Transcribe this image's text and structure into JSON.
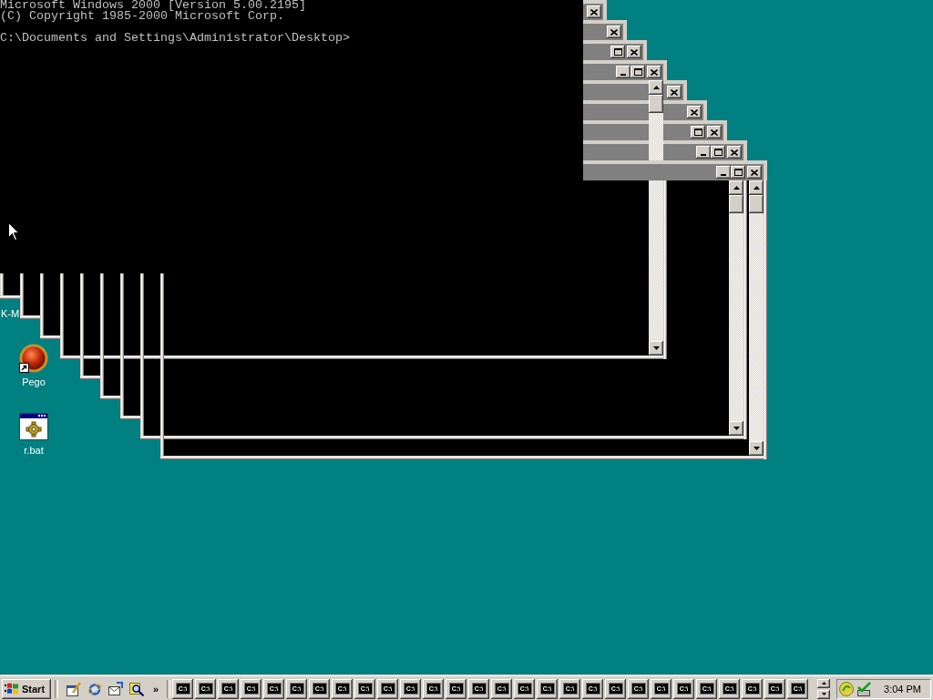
{
  "console": {
    "lines": [
      "Microsoft Windows 2000 [Version 5.00.2195]",
      "(C) Copyright 1985-2000 Microsoft Corp."
    ],
    "prompt": "C:\\Documents and Settings\\Administrator\\Desktop>"
  },
  "console_windows": [
    {
      "title_buttons": [
        {
          "kind": "close"
        }
      ],
      "scrollbar": false
    },
    {
      "title_buttons": [
        {
          "kind": "close"
        }
      ],
      "scrollbar": false
    },
    {
      "title_buttons": [
        {
          "kind": "maximize"
        },
        {
          "kind": "close"
        }
      ],
      "scrollbar": false
    },
    {
      "title_buttons": [
        {
          "kind": "minimize"
        },
        {
          "kind": "maximize"
        },
        {
          "kind": "close"
        }
      ],
      "scrollbar": true
    },
    {
      "title_buttons": [
        {
          "kind": "close"
        }
      ],
      "scrollbar": false
    },
    {
      "title_buttons": [
        {
          "kind": "close"
        }
      ],
      "scrollbar": false
    },
    {
      "title_buttons": [
        {
          "kind": "maximize"
        },
        {
          "kind": "close"
        }
      ],
      "scrollbar": false
    },
    {
      "title_buttons": [
        {
          "kind": "minimize"
        },
        {
          "kind": "maximize"
        },
        {
          "kind": "close"
        }
      ],
      "scrollbar": true
    },
    {
      "title_buttons": [
        {
          "kind": "minimize"
        },
        {
          "kind": "maximize"
        },
        {
          "kind": "close"
        }
      ],
      "scrollbar": true
    }
  ],
  "desktop_icons": [
    {
      "label": "K-M"
    },
    {
      "label": "Pego",
      "kind": "ball",
      "shortcut": true
    },
    {
      "label": "r.bat",
      "kind": "batch",
      "shortcut": false
    }
  ],
  "taskbar": {
    "start": {
      "label": "Start"
    },
    "quick_launch": [
      {
        "kind": "desktop"
      },
      {
        "kind": "browser"
      },
      {
        "kind": "mail"
      },
      {
        "kind": "search"
      }
    ],
    "quick_launch_more": "»",
    "tasks": [
      {
        "icon_text": "C:\\",
        "selected": false
      },
      {
        "icon_text": "C:\\",
        "selected": false
      },
      {
        "icon_text": "C:\\",
        "selected": false
      },
      {
        "icon_text": "C:\\",
        "selected": false
      },
      {
        "icon_text": "C:\\",
        "selected": false
      },
      {
        "icon_text": "C:\\",
        "selected": false
      },
      {
        "icon_text": "C:\\",
        "selected": false
      },
      {
        "icon_text": "C:\\",
        "selected": false
      },
      {
        "icon_text": "C:\\",
        "selected": false
      },
      {
        "icon_text": "C:\\",
        "selected": false
      },
      {
        "icon_text": "C:\\",
        "selected": false
      },
      {
        "icon_text": "C:\\",
        "selected": false
      },
      {
        "icon_text": "C:\\",
        "selected": false
      },
      {
        "icon_text": "C:\\",
        "selected": false
      },
      {
        "icon_text": "C:\\",
        "selected": false
      },
      {
        "icon_text": "C:\\",
        "selected": false
      },
      {
        "icon_text": "C:\\",
        "selected": false
      },
      {
        "icon_text": "C:\\",
        "selected": false
      },
      {
        "icon_text": "C:\\",
        "selected": false
      },
      {
        "icon_text": "C:\\",
        "selected": false
      },
      {
        "icon_text": "C:\\",
        "selected": false
      },
      {
        "icon_text": "C:\\",
        "selected": false
      },
      {
        "icon_text": "C:\\",
        "selected": false
      },
      {
        "icon_text": "C:\\",
        "selected": false
      },
      {
        "icon_text": "C:\\",
        "selected": false
      },
      {
        "icon_text": "C:\\",
        "selected": false
      },
      {
        "icon_text": "C:\\",
        "selected": false
      },
      {
        "icon_text": "C:\\",
        "selected": false
      }
    ],
    "tray_icons": [
      {
        "kind": "disc"
      },
      {
        "kind": "check"
      }
    ],
    "clock": "3:04 PM"
  }
}
